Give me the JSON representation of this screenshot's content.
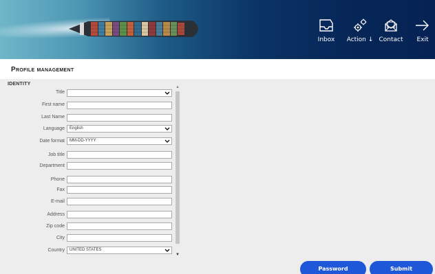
{
  "header": {
    "nav": {
      "inbox": "Inbox",
      "action": "Action ↓",
      "contact": "Contact",
      "exit": "Exit"
    }
  },
  "page": {
    "title": "Profile management"
  },
  "form": {
    "section_title": "IDENTITY",
    "labels": {
      "title": "Title",
      "first_name": "First name",
      "last_name": "Last Name",
      "language": "Language",
      "date_format": "Date format",
      "job_title": "Job title",
      "department": "Department",
      "phone": "Phone",
      "fax": "Fax",
      "email": "E-mail",
      "address": "Address",
      "zip_code": "Zip code",
      "city": "City",
      "country": "Country"
    },
    "values": {
      "title": "",
      "first_name": "",
      "last_name": "",
      "language": "English",
      "date_format": "MM-DD-YYYY",
      "job_title": "",
      "department": "",
      "phone": "",
      "fax": "",
      "email": "",
      "address": "",
      "zip_code": "",
      "city": "",
      "country": "UNITED STATES"
    }
  },
  "buttons": {
    "password": "Password",
    "submit": "Submit"
  },
  "colors": {
    "header_dark": "#062254",
    "button_blue": "#1f57d9",
    "content_bg": "#ededed"
  }
}
